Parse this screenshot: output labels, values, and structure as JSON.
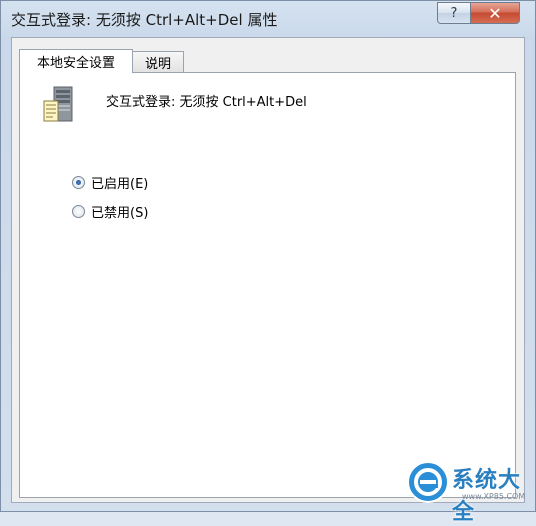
{
  "window": {
    "title": "交互式登录: 无须按 Ctrl+Alt+Del 属性",
    "help_label": "?",
    "close_label": "✕"
  },
  "tabs": [
    {
      "label": "本地安全设置",
      "active": true
    },
    {
      "label": "说明",
      "active": false
    }
  ],
  "policy": {
    "icon": "server-icon",
    "name": "交互式登录: 无须按 Ctrl+Alt+Del"
  },
  "options": [
    {
      "label": "已启用(E)",
      "selected": true
    },
    {
      "label": "已禁用(S)",
      "selected": false
    }
  ],
  "watermark": {
    "logo": "xp85-logo",
    "text": "系统大全",
    "url": "www.XP85.COM"
  },
  "colors": {
    "accent": "#2a7fc0",
    "close_button": "#c54a31"
  }
}
